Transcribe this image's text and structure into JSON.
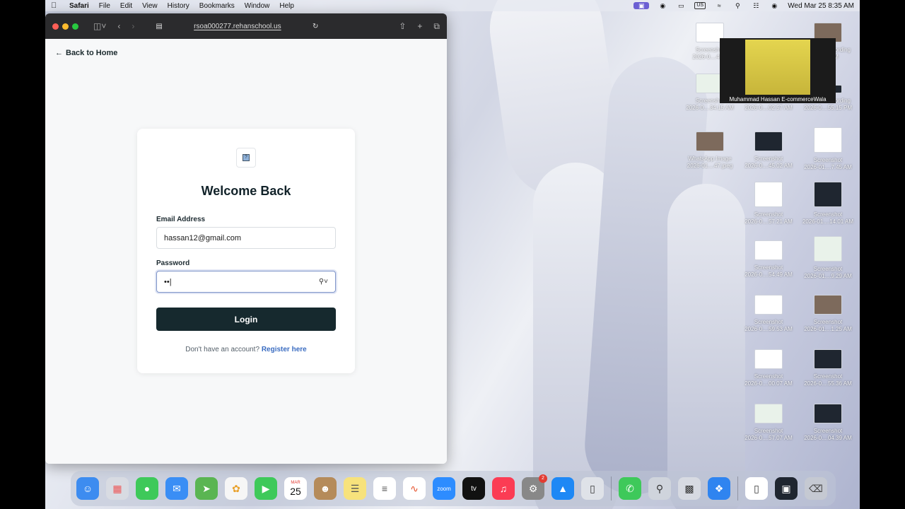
{
  "menubar": {
    "app": "Safari",
    "items": [
      "File",
      "Edit",
      "View",
      "History",
      "Bookmarks",
      "Window",
      "Help"
    ],
    "input_source": "US",
    "datetime": "Wed Mar 25  8:35 AM"
  },
  "browser": {
    "url": "rsoa000277.rehanschool.us"
  },
  "page": {
    "back_link": "Back to Home",
    "title": "Welcome Back",
    "email_label": "Email Address",
    "email_value": "hassan12@gmail.com",
    "password_label": "Password",
    "password_value": "••",
    "login_label": "Login",
    "register_prompt": "Don't have an account?",
    "register_link": "Register here"
  },
  "video": {
    "participant": "Muhammad Hassan E-commerceWala"
  },
  "desktop_icons": [
    {
      "name": "Screenshot",
      "sub": "2026-0....42..."
    },
    {
      "name": "Screen Recording",
      "sub": "...34 PM"
    },
    {
      "name": "Screenshot",
      "sub": "2026-0....34.15 AM"
    },
    {
      "name": "Screenshot",
      "sub": "2026-0....02.57 AM"
    },
    {
      "name": "Screen Recording",
      "sub": "2026-0....55.15 PM"
    },
    {
      "name": "WhatsApp Image",
      "sub": "2026-01....47.jpeg"
    },
    {
      "name": "Screenshot",
      "sub": "2026-0....45.02 AM"
    },
    {
      "name": "Screenshot",
      "sub": "2026-01....7.45 AM"
    },
    {
      "name": "Screenshot",
      "sub": "2026-0....57.21 AM"
    },
    {
      "name": "Screenshot",
      "sub": "2026-01....14.01 AM"
    },
    {
      "name": "Screenshot",
      "sub": "2026-0....54.49 AM"
    },
    {
      "name": "Screenshot",
      "sub": "2026-01....9.29 AM"
    },
    {
      "name": "Screenshot",
      "sub": "2026-0....59.53 AM"
    },
    {
      "name": "Screenshot",
      "sub": "2026-01....1.25 AM"
    },
    {
      "name": "Screenshot",
      "sub": "2026-0....00.07 AM"
    },
    {
      "name": "Screenshot",
      "sub": "2026-0....55.36 AM"
    },
    {
      "name": "Screenshot",
      "sub": "2026-0....57.07 AM"
    },
    {
      "name": "Screenshot",
      "sub": "2026-0....04.39 AM"
    }
  ],
  "dock": {
    "calendar_month": "MAR",
    "calendar_day": "25",
    "zoom_label": "zoom",
    "tv_label": "tv",
    "settings_badge": "2"
  },
  "colors": {
    "primary_button": "#16292e",
    "link": "#3a6cc1"
  }
}
